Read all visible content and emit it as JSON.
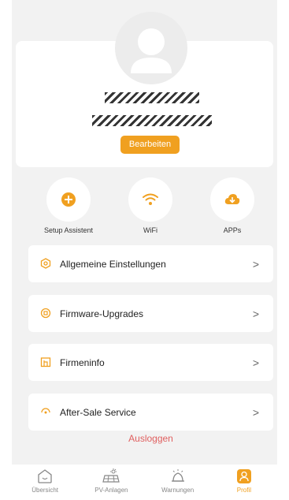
{
  "profile": {
    "edit_label": "Bearbeiten"
  },
  "quick_actions": [
    {
      "label": "Setup Assistent",
      "icon": "plus-icon"
    },
    {
      "label": "WiFi",
      "icon": "wifi-icon"
    },
    {
      "label": "APPs",
      "icon": "cloud-download-icon"
    }
  ],
  "menu": [
    {
      "label": "Allgemeine Einstellungen",
      "icon": "settings-hex-icon"
    },
    {
      "label": "Firmware-Upgrades",
      "icon": "chip-icon"
    },
    {
      "label": "Firmeninfo",
      "icon": "building-icon"
    },
    {
      "label": "After-Sale Service",
      "icon": "service-icon"
    }
  ],
  "logout_label": "Ausloggen",
  "tabs": [
    {
      "label": "Übersicht",
      "icon": "home-icon",
      "active": false
    },
    {
      "label": "PV-Anlagen",
      "icon": "solar-panel-icon",
      "active": false
    },
    {
      "label": "Warnungen",
      "icon": "bell-icon",
      "active": false
    },
    {
      "label": "Profil",
      "icon": "profile-icon",
      "active": true
    }
  ],
  "colors": {
    "accent": "#f0a020",
    "logout": "#e06060",
    "background": "#f2f2f2"
  }
}
